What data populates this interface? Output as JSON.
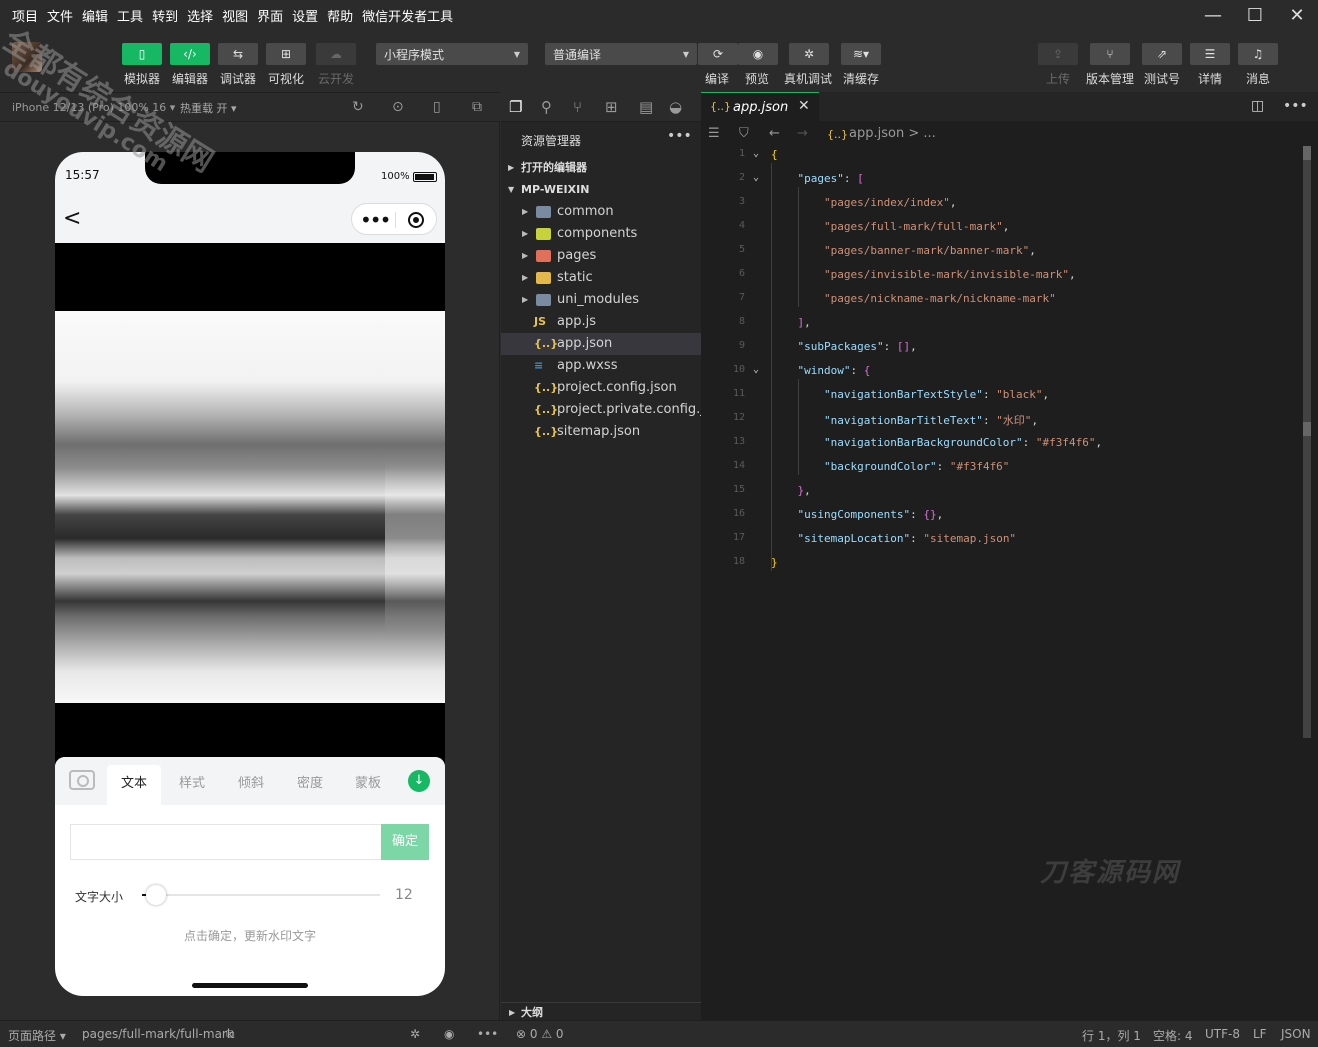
{
  "menubar": {
    "items": [
      "项目",
      "文件",
      "编辑",
      "工具",
      "转到",
      "选择",
      "视图",
      "界面",
      "设置",
      "帮助",
      "微信开发者工具"
    ]
  },
  "toolbar": {
    "simulator": "模拟器",
    "editor": "编辑器",
    "debugger": "调试器",
    "visual": "可视化",
    "cloud": "云开发",
    "mode_select": "小程序模式",
    "compile_select": "普通编译",
    "compile": "编译",
    "preview": "预览",
    "remote_debug": "真机调试",
    "clear_cache": "清缓存",
    "upload": "上传",
    "version": "版本管理",
    "test": "测试号",
    "details": "详情",
    "messages": "消息"
  },
  "simulator": {
    "device": "iPhone 12/13 (Pro) 100% 16 ▾",
    "hot_reload": "热重载 开 ▾",
    "time": "15:57",
    "battery": "100%",
    "tabs": [
      "文本",
      "样式",
      "倾斜",
      "密度",
      "蒙板"
    ],
    "active_tab": "文本",
    "confirm": "确定",
    "size_label": "文字大小",
    "size_value": "12",
    "size_fraction": 0.06,
    "hint": "点击确定，更新水印文字"
  },
  "explorer": {
    "title": "资源管理器",
    "open_editors": "打开的编辑器",
    "project": "MP-WEIXIN",
    "outline": "大纲",
    "files": [
      {
        "name": "common",
        "type": "folder",
        "color": "#7a8aa0"
      },
      {
        "name": "components",
        "type": "folder",
        "color": "#c6d13c"
      },
      {
        "name": "pages",
        "type": "folder",
        "color": "#e0705a"
      },
      {
        "name": "static",
        "type": "folder",
        "color": "#e4b84a"
      },
      {
        "name": "uni_modules",
        "type": "folder",
        "color": "#7a8aa0"
      },
      {
        "name": "app.js",
        "type": "js",
        "color": "#e8c44a",
        "glyph": "JS"
      },
      {
        "name": "app.json",
        "type": "json",
        "color": "#e8c44a",
        "glyph": "{..}",
        "selected": true
      },
      {
        "name": "app.wxss",
        "type": "wxss",
        "color": "#3d8fd8",
        "glyph": "≡"
      },
      {
        "name": "project.config.json",
        "type": "json",
        "color": "#e8c44a",
        "glyph": "{..}"
      },
      {
        "name": "project.private.config.js...",
        "type": "json",
        "color": "#e8c44a",
        "glyph": "{..}"
      },
      {
        "name": "sitemap.json",
        "type": "json",
        "color": "#e8c44a",
        "glyph": "{..}"
      }
    ]
  },
  "editor": {
    "tab": "app.json",
    "breadcrumb": "app.json > ...",
    "lines": [
      [
        {
          "t": "{",
          "c": "b"
        }
      ],
      [
        {
          "t": "    "
        },
        {
          "t": "\"pages\"",
          "c": "k"
        },
        {
          "t": ": "
        },
        {
          "t": "[",
          "c": "p"
        }
      ],
      [
        {
          "t": "        "
        },
        {
          "t": "\"pages/index/index\"",
          "c": "s"
        },
        {
          "t": ","
        }
      ],
      [
        {
          "t": "        "
        },
        {
          "t": "\"pages/full-mark/full-mark\"",
          "c": "s"
        },
        {
          "t": ","
        }
      ],
      [
        {
          "t": "        "
        },
        {
          "t": "\"pages/banner-mark/banner-mark\"",
          "c": "s"
        },
        {
          "t": ","
        }
      ],
      [
        {
          "t": "        "
        },
        {
          "t": "\"pages/invisible-mark/invisible-mark\"",
          "c": "s"
        },
        {
          "t": ","
        }
      ],
      [
        {
          "t": "        "
        },
        {
          "t": "\"pages/nickname-mark/nickname-mark\"",
          "c": "s"
        }
      ],
      [
        {
          "t": "    "
        },
        {
          "t": "]",
          "c": "p"
        },
        {
          "t": ","
        }
      ],
      [
        {
          "t": "    "
        },
        {
          "t": "\"subPackages\"",
          "c": "k"
        },
        {
          "t": ": "
        },
        {
          "t": "[]",
          "c": "p"
        },
        {
          "t": ","
        }
      ],
      [
        {
          "t": "    "
        },
        {
          "t": "\"window\"",
          "c": "k"
        },
        {
          "t": ": "
        },
        {
          "t": "{",
          "c": "p"
        }
      ],
      [
        {
          "t": "        "
        },
        {
          "t": "\"navigationBarTextStyle\"",
          "c": "k"
        },
        {
          "t": ": "
        },
        {
          "t": "\"black\"",
          "c": "s"
        },
        {
          "t": ","
        }
      ],
      [
        {
          "t": "        "
        },
        {
          "t": "\"navigationBarTitleText\"",
          "c": "k"
        },
        {
          "t": ": "
        },
        {
          "t": "\"水印\"",
          "c": "s"
        },
        {
          "t": ","
        }
      ],
      [
        {
          "t": "        "
        },
        {
          "t": "\"navigationBarBackgroundColor\"",
          "c": "k"
        },
        {
          "t": ": "
        },
        {
          "t": "\"#f3f4f6\"",
          "c": "s"
        },
        {
          "t": ","
        }
      ],
      [
        {
          "t": "        "
        },
        {
          "t": "\"backgroundColor\"",
          "c": "k"
        },
        {
          "t": ": "
        },
        {
          "t": "\"#f3f4f6\"",
          "c": "s"
        }
      ],
      [
        {
          "t": "    "
        },
        {
          "t": "}",
          "c": "p"
        },
        {
          "t": ","
        }
      ],
      [
        {
          "t": "    "
        },
        {
          "t": "\"usingComponents\"",
          "c": "k"
        },
        {
          "t": ": "
        },
        {
          "t": "{}",
          "c": "p"
        },
        {
          "t": ","
        }
      ],
      [
        {
          "t": "    "
        },
        {
          "t": "\"sitemapLocation\"",
          "c": "k"
        },
        {
          "t": ": "
        },
        {
          "t": "\"sitemap.json\"",
          "c": "s"
        }
      ],
      [
        {
          "t": "}",
          "c": "b"
        }
      ]
    ]
  },
  "statusbar": {
    "page_path_label": "页面路径 ▾",
    "page_path": "pages/full-mark/full-mark",
    "problems": "⊗ 0 ⚠ 0",
    "position": "行 1，列 1",
    "spaces": "空格: 4",
    "encoding": "UTF-8",
    "eol": "LF",
    "language": "JSON"
  },
  "watermark": {
    "line1": "全都有综合资源网",
    "line2": "douyouvip.com",
    "corner": "刀客源码网"
  }
}
